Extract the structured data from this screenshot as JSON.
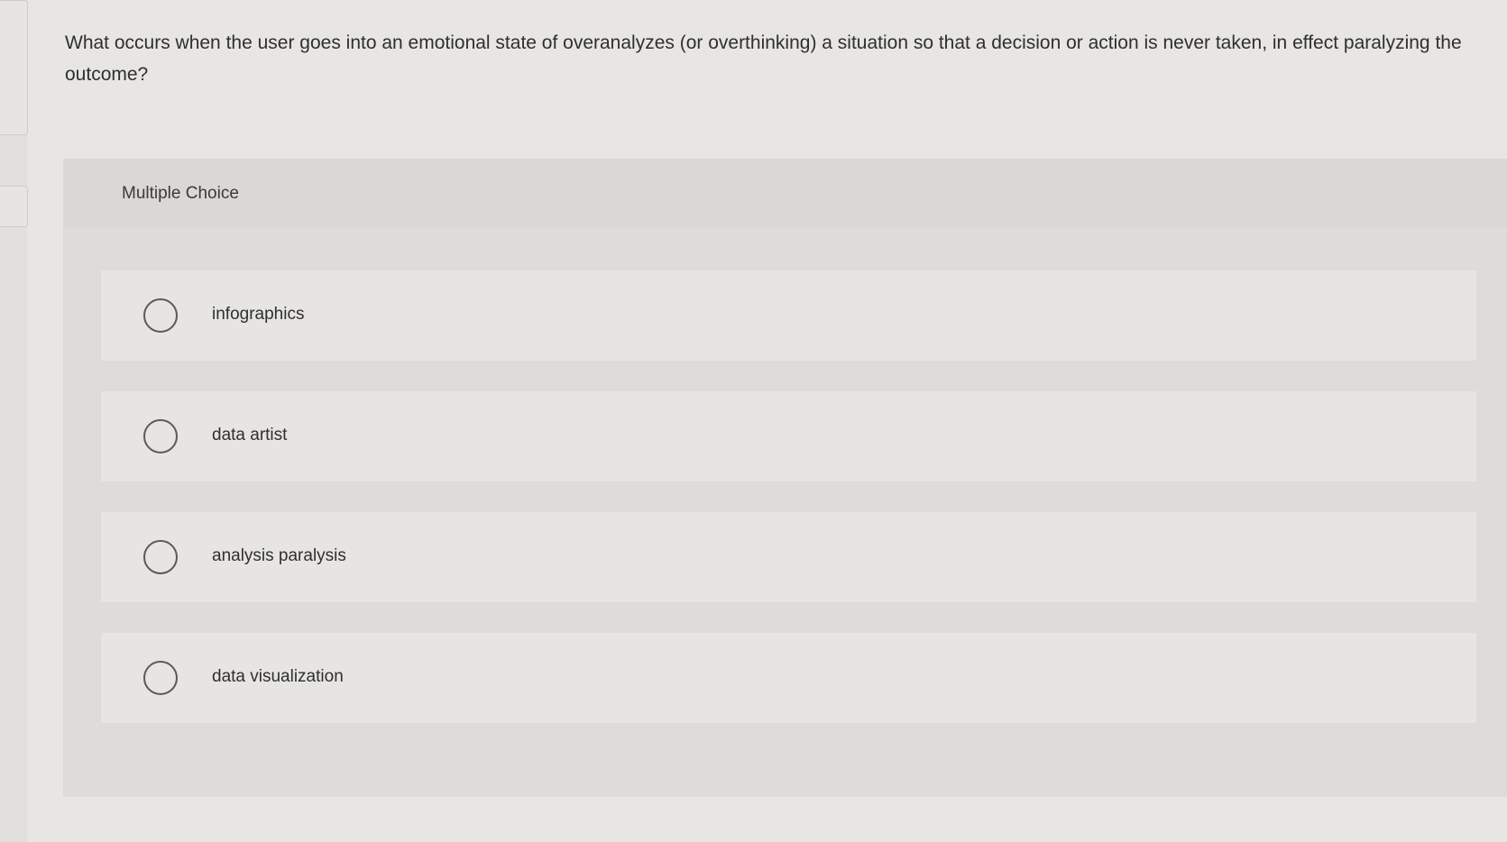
{
  "question": {
    "text": "What occurs when the user goes into an emotional state of overanalyzes (or overthinking) a situation so that a decision or action is never taken, in effect paralyzing the outcome?"
  },
  "multiple_choice": {
    "label": "Multiple Choice",
    "options": [
      {
        "label": "infographics",
        "selected": false
      },
      {
        "label": "data artist",
        "selected": false
      },
      {
        "label": "analysis paralysis",
        "selected": false
      },
      {
        "label": "data visualization",
        "selected": false
      }
    ]
  }
}
